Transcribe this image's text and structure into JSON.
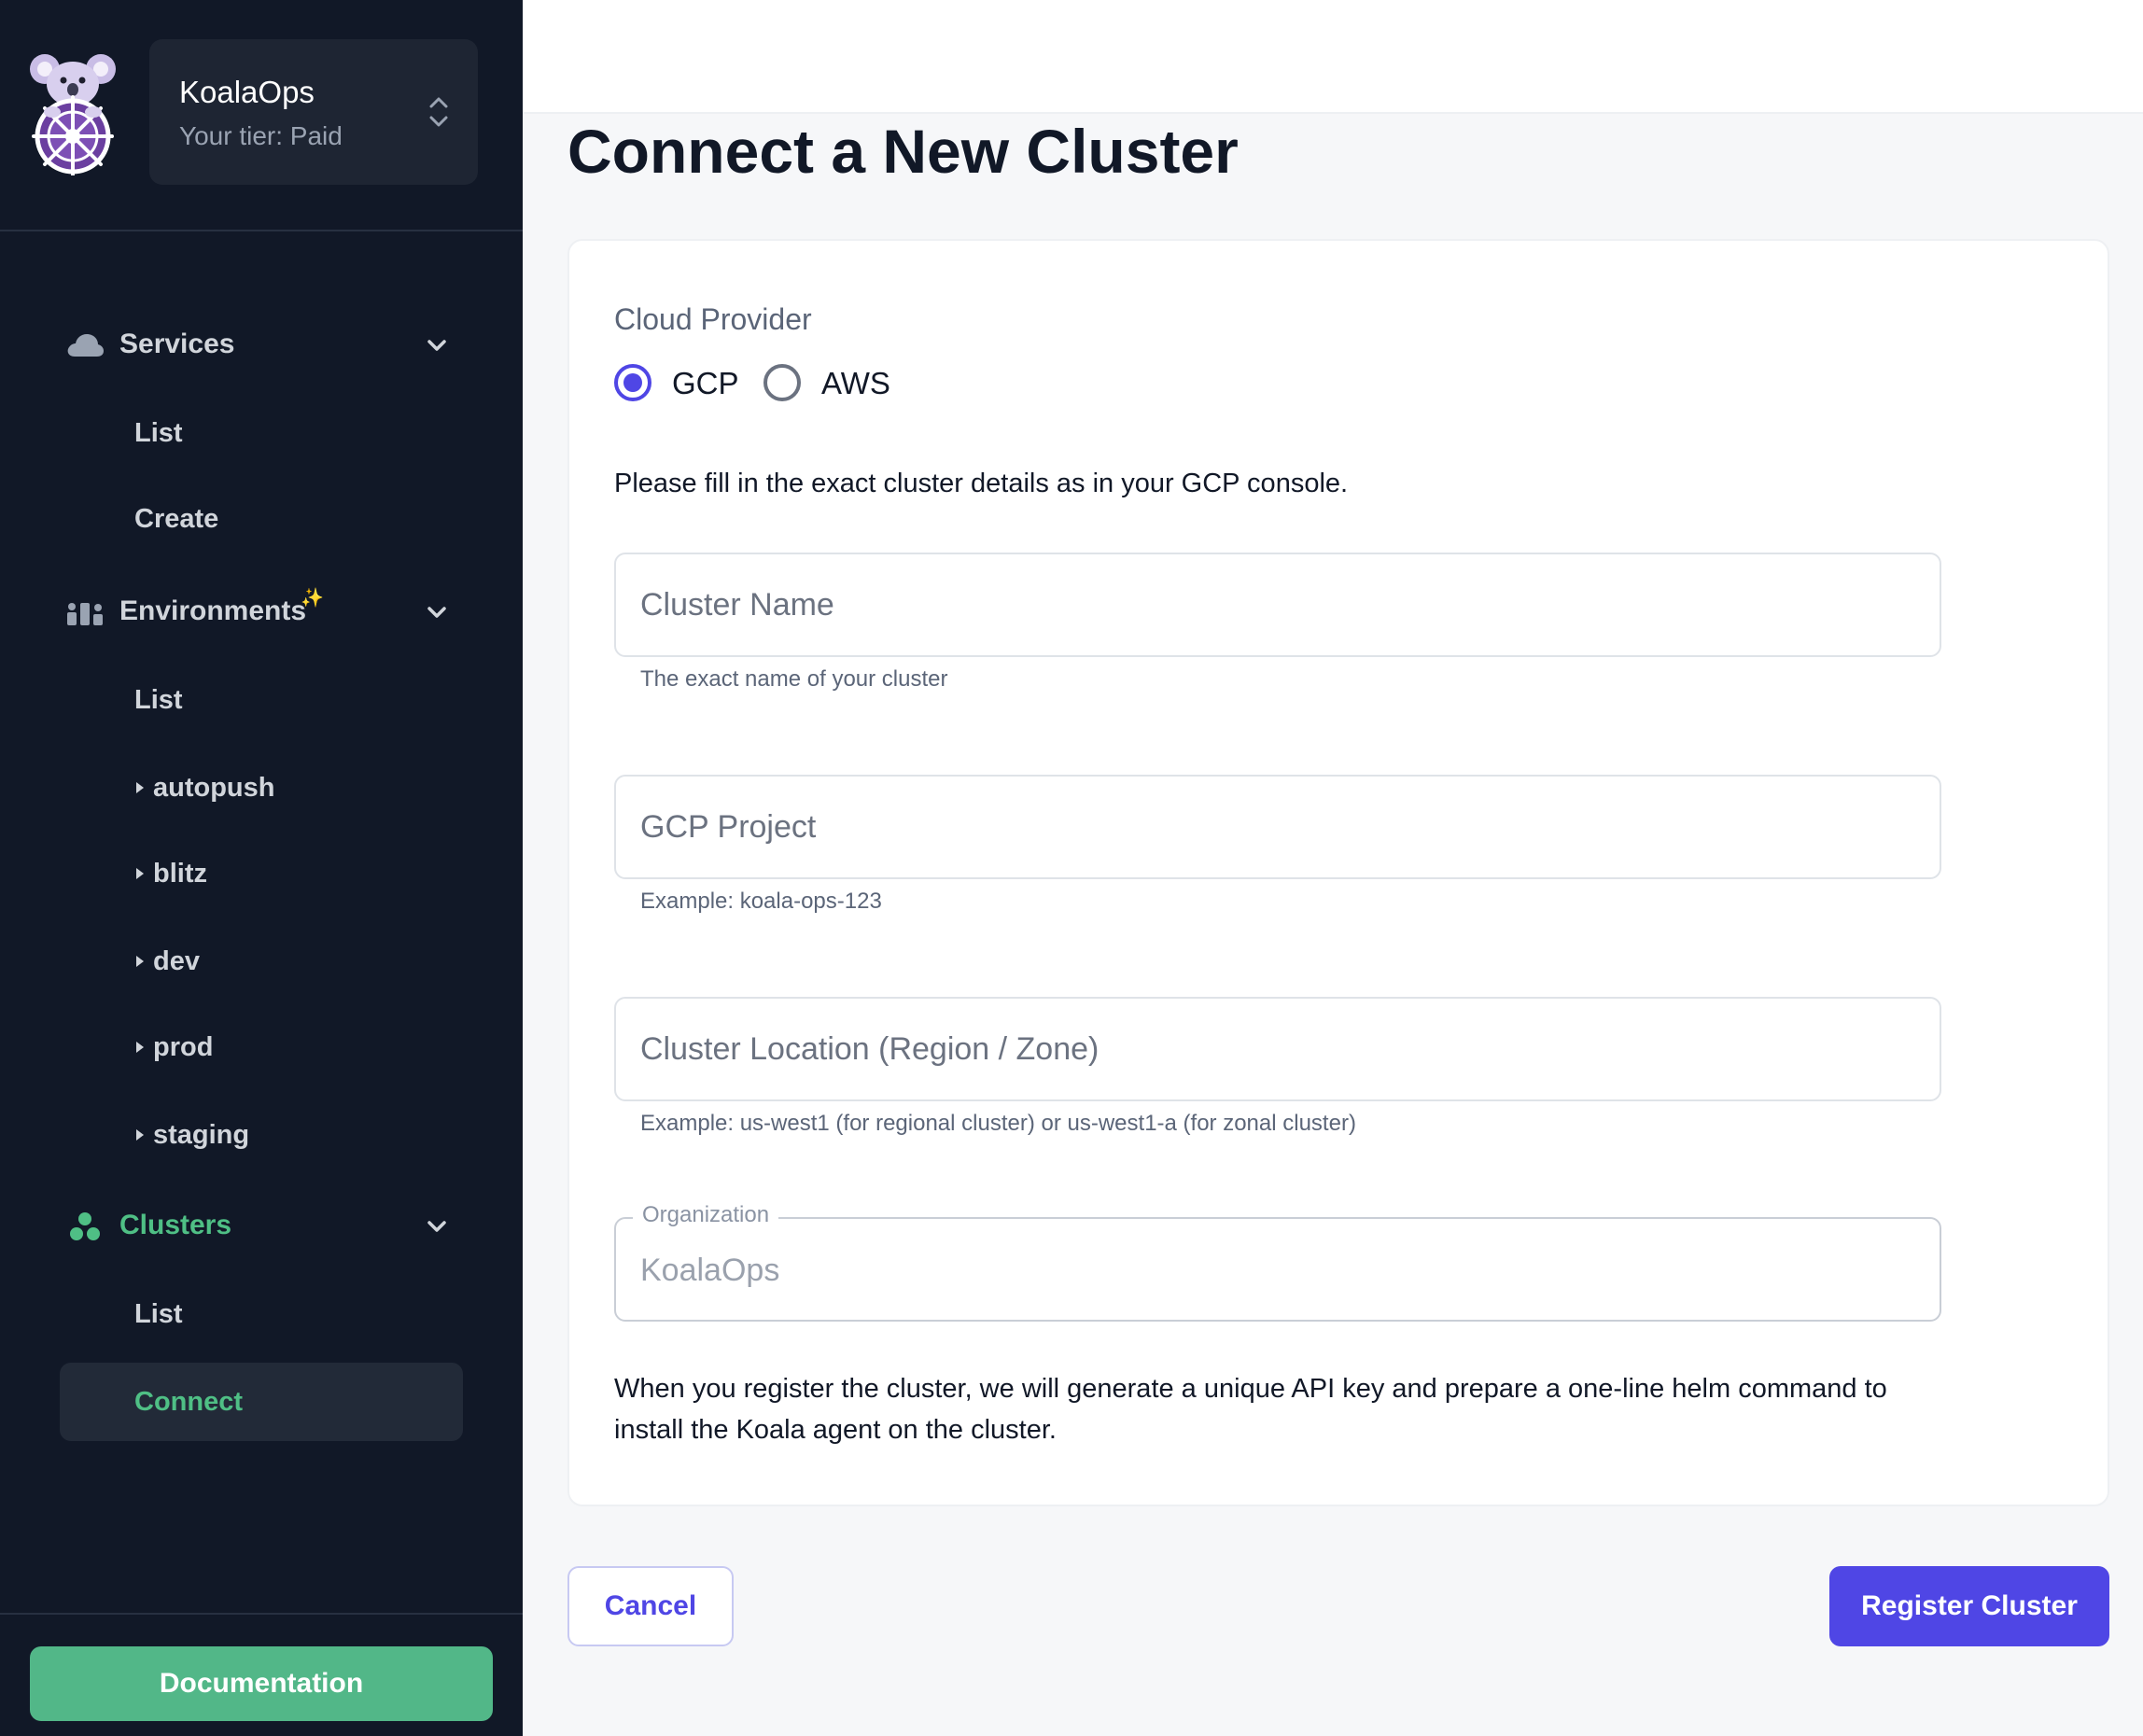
{
  "sidebar": {
    "org_name": "KoalaOps",
    "tier": "Your tier: Paid",
    "sections": {
      "services": {
        "label": "Services",
        "icon": "cloud-icon",
        "items": [
          "List",
          "Create"
        ]
      },
      "environments": {
        "label": "Environments",
        "icon": "environments-icon",
        "badge": "✨",
        "items": [
          "List",
          "autopush",
          "blitz",
          "dev",
          "prod",
          "staging"
        ]
      },
      "clusters": {
        "label": "Clusters",
        "icon": "clusters-icon",
        "items": [
          "List",
          "Connect"
        ],
        "selected": "Connect"
      }
    },
    "documentation_label": "Documentation"
  },
  "main": {
    "title": "Connect a New Cluster",
    "cloud_provider_label": "Cloud Provider",
    "providers": [
      {
        "label": "GCP",
        "checked": true
      },
      {
        "label": "AWS",
        "checked": false
      }
    ],
    "instructions": "Please fill in the exact cluster details as in your GCP console.",
    "fields": {
      "cluster_name": {
        "placeholder": "Cluster Name",
        "value": "",
        "helper": "The exact name of your cluster"
      },
      "gcp_project": {
        "placeholder": "GCP Project",
        "value": "",
        "helper": "Example: koala-ops-123"
      },
      "cluster_location": {
        "placeholder": "Cluster Location (Region / Zone)",
        "value": "",
        "helper": "Example: us-west1 (for regional cluster) or us-west1-a (for zonal cluster)"
      },
      "organization": {
        "label": "Organization",
        "value": "KoalaOps"
      }
    },
    "footer_note": "When you register the cluster, we will generate a unique API key and prepare a one-line helm command to install the Koala agent on the cluster.",
    "cancel_label": "Cancel",
    "register_label": "Register Cluster"
  },
  "colors": {
    "sidebar_bg": "#111827",
    "accent_green": "#4fbf85",
    "primary": "#4f46e5",
    "doc_button": "#52b788"
  }
}
